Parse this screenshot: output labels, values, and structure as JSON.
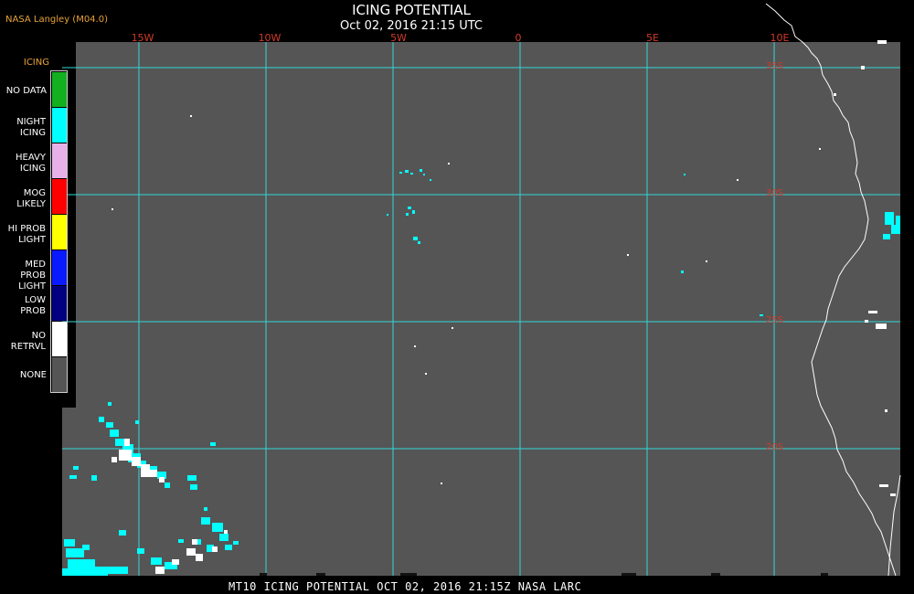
{
  "header": {
    "provider": "NASA Langley (M04.0)",
    "title": "ICING POTENTIAL",
    "subtitle": "Oct 02, 2016 21:15 UTC"
  },
  "footer": {
    "caption": "MT10  ICING POTENTIAL   OCT 02, 2016 21:15Z   NASA LARC"
  },
  "map": {
    "longitude_labels": [
      "15W",
      "10W",
      "5W",
      "0",
      "5E",
      "10E"
    ],
    "latitude_labels": [
      "35S",
      "30S",
      "25S",
      "20S"
    ],
    "colors": {
      "background": "#000000",
      "no_retrieval_area": "#555555",
      "grid": "#33d6d6",
      "coastline": "#ffffff",
      "grid_label": "#d23a2a"
    }
  },
  "legend": {
    "title": "ICING",
    "items": [
      {
        "label": "NO DATA",
        "color": "#12b020"
      },
      {
        "label": "NIGHT ICING",
        "color": "#00ffff"
      },
      {
        "label": "HEAVY ICING",
        "color": "#e8b0e8"
      },
      {
        "label": "MOG LIKELY",
        "color": "#ff0000"
      },
      {
        "label": "HI PROB LIGHT",
        "color": "#ffff00"
      },
      {
        "label": "MED PROB LIGHT",
        "color": "#0a1aff"
      },
      {
        "label": "LOW PROB",
        "color": "#000080"
      },
      {
        "label": "NO RETRVL",
        "color": "#ffffff"
      },
      {
        "label": "NONE",
        "color": "#555555"
      }
    ]
  }
}
